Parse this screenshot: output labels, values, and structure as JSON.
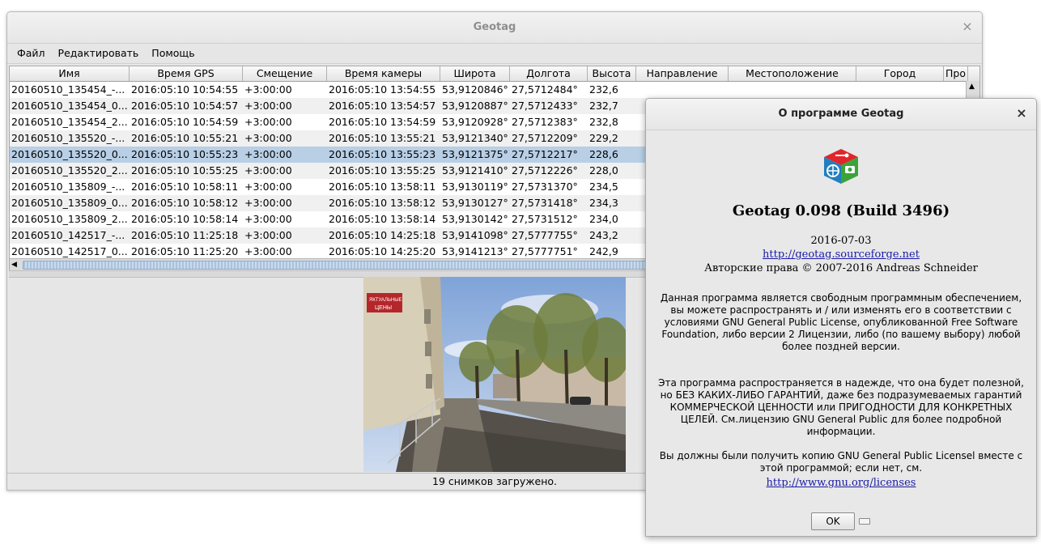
{
  "window": {
    "title": "Geotag",
    "close_icon": "×"
  },
  "menu": [
    "Файл",
    "Редактировать",
    "Помощь"
  ],
  "table": {
    "columns": [
      "Имя",
      "Время GPS",
      "Смещение",
      "Время камеры",
      "Широта",
      "Долгота",
      "Высота",
      "Направление",
      "Местоположение",
      "Город",
      "Про"
    ],
    "rows": [
      [
        "20160510_135454_-...",
        "2016:05:10 10:54:55",
        "+3:00:00",
        "2016:05:10 13:54:55",
        "53,9120846°",
        "27,5712484°",
        "232,6"
      ],
      [
        "20160510_135454_0...",
        "2016:05:10 10:54:57",
        "+3:00:00",
        "2016:05:10 13:54:57",
        "53,9120887°",
        "27,5712433°",
        "232,7"
      ],
      [
        "20160510_135454_2...",
        "2016:05:10 10:54:59",
        "+3:00:00",
        "2016:05:10 13:54:59",
        "53,9120928°",
        "27,5712383°",
        "232,8"
      ],
      [
        "20160510_135520_-...",
        "2016:05:10 10:55:21",
        "+3:00:00",
        "2016:05:10 13:55:21",
        "53,9121340°",
        "27,5712209°",
        "229,2"
      ],
      [
        "20160510_135520_0...",
        "2016:05:10 10:55:23",
        "+3:00:00",
        "2016:05:10 13:55:23",
        "53,9121375°",
        "27,5712217°",
        "228,6"
      ],
      [
        "20160510_135520_2...",
        "2016:05:10 10:55:25",
        "+3:00:00",
        "2016:05:10 13:55:25",
        "53,9121410°",
        "27,5712226°",
        "228,0"
      ],
      [
        "20160510_135809_-...",
        "2016:05:10 10:58:11",
        "+3:00:00",
        "2016:05:10 13:58:11",
        "53,9130119°",
        "27,5731370°",
        "234,5"
      ],
      [
        "20160510_135809_0...",
        "2016:05:10 10:58:12",
        "+3:00:00",
        "2016:05:10 13:58:12",
        "53,9130127°",
        "27,5731418°",
        "234,3"
      ],
      [
        "20160510_135809_2...",
        "2016:05:10 10:58:14",
        "+3:00:00",
        "2016:05:10 13:58:14",
        "53,9130142°",
        "27,5731512°",
        "234,0"
      ],
      [
        "20160510_142517_-...",
        "2016:05:10 11:25:18",
        "+3:00:00",
        "2016:05:10 14:25:18",
        "53,9141098°",
        "27,5777755°",
        "243,2"
      ],
      [
        "20160510_142517_0...",
        "2016:05:10 11:25:20",
        "+3:00:00",
        "2016:05:10 14:25:20",
        "53,9141213°",
        "27,5777751°",
        "242,9"
      ]
    ],
    "selected_row": 4
  },
  "preview_sign": "ЯКТУАЛЬНЫЕ\nЦЕНЫ",
  "status": "19 снимков загружено.",
  "about": {
    "title": "О программе Geotag",
    "close_icon": "×",
    "app_name": "Geotag 0.098 (Build 3496)",
    "date": "2016-07-03",
    "website": "http://geotag.sourceforge.net",
    "copyright": "Авторские права © 2007-2016 Andreas Schneider",
    "para1": "Данная программа является свободным программным обеспечением, вы можете распространять и / или изменять его в соответствии с условиями GNU General Public License, опубликованной Free Software Foundation, либо версии 2 Лицензии, либо (по вашему выбору) любой более поздней версии.",
    "para2": "Эта программа распространяется в надежде, что она будет полезной, но БЕЗ КАКИХ-ЛИБО ГАРАНТИЙ, даже без подразумеваемых гарантий КОММЕРЧЕСКОЙ ЦЕННОСТИ или ПРИГОДНОСТИ ДЛЯ КОНКРЕТНЫХ ЦЕЛЕЙ. См.лицензию GNU General Public для более подробной информации.",
    "para3": "Вы должны были получить копию GNU General Public Licensel вместе с этой программой; если нет, см.",
    "license_link": "http://www.gnu.org/licenses",
    "ok_label": "OK"
  }
}
